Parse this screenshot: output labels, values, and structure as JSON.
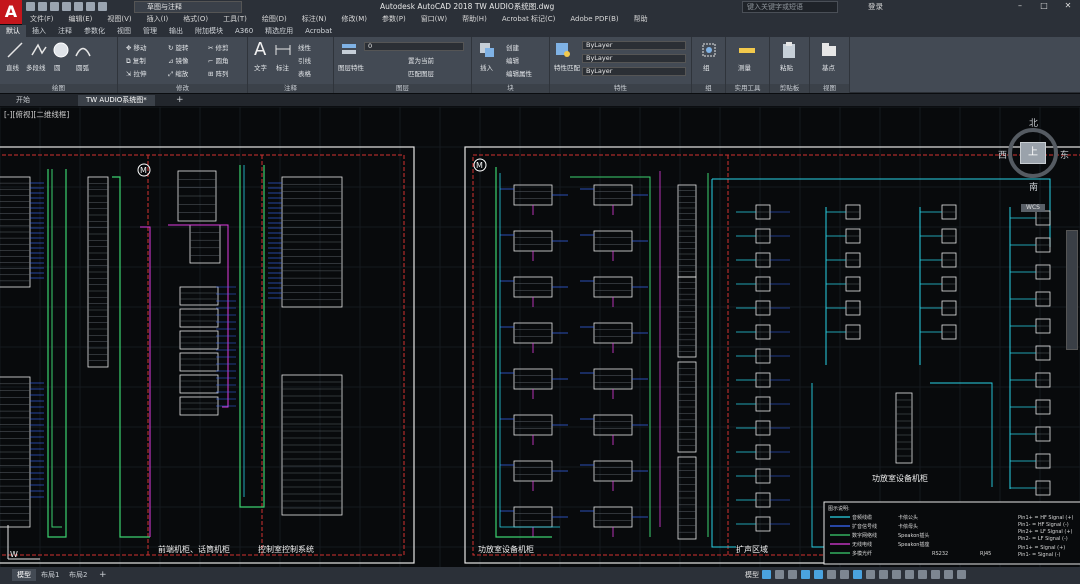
{
  "app": {
    "title": "Autodesk AutoCAD 2018    TW AUDIO系统图.dwg",
    "logo_letter": "A",
    "workspace": "草图与注释",
    "search_placeholder": "键入关键字或短语",
    "login": "登录"
  },
  "menu": [
    "文件(F)",
    "编辑(E)",
    "视图(V)",
    "插入(I)",
    "格式(O)",
    "工具(T)",
    "绘图(D)",
    "标注(N)",
    "修改(M)",
    "参数(P)",
    "窗口(W)",
    "帮助(H)",
    "Acrobat 标记(C)",
    "Adobe PDF(B)",
    "帮助"
  ],
  "ribbon_tabs": [
    "默认",
    "插入",
    "注释",
    "参数化",
    "视图",
    "管理",
    "输出",
    "附加模块",
    "A360",
    "精选应用",
    "Acrobat"
  ],
  "ribbon": {
    "draw": {
      "label": "绘图",
      "tools": [
        "直线",
        "多段线",
        "圆",
        "圆弧"
      ]
    },
    "modify": {
      "label": "修改",
      "tools": [
        "移动",
        "旋转",
        "修剪",
        "复制",
        "镜像",
        "圆角",
        "拉伸",
        "缩放",
        "阵列"
      ]
    },
    "annotation": {
      "label": "注释",
      "tools": [
        "文字",
        "标注",
        "线性",
        "引线",
        "表格"
      ]
    },
    "layers": {
      "label": "图层",
      "tools": [
        "图层特性",
        "置为当前",
        "匹配图层"
      ],
      "current_layer": "0"
    },
    "block": {
      "label": "块",
      "tools": [
        "插入",
        "创建",
        "编辑",
        "编辑属性"
      ]
    },
    "properties": {
      "label": "特性",
      "tools": [
        "特性匹配"
      ],
      "color": "ByLayer",
      "linetype": "ByLayer",
      "lineweight": "ByLayer"
    },
    "groups": {
      "label": "组",
      "tools": [
        "组"
      ]
    },
    "utilities": {
      "label": "实用工具",
      "tools": [
        "测量"
      ]
    },
    "clipboard": {
      "label": "剪贴板",
      "tools": [
        "粘贴"
      ]
    },
    "view": {
      "label": "视图",
      "tools": [
        "基点"
      ]
    }
  },
  "file_tabs": [
    "开始",
    "TW AUDIO系统图*"
  ],
  "viewport_label": "[-][俯视][二维线框]",
  "viewcube": {
    "north": "北",
    "south": "南",
    "east": "东",
    "west": "西",
    "top": "上",
    "wcs": "WCS"
  },
  "drawing": {
    "left_sheet_labels": [
      "前端机柜、话筒机柜",
      "控制室控制系统"
    ],
    "right_sheet_labels": [
      "功放室设备机柜",
      "扩声区域",
      "功放室设备机柜"
    ],
    "legend_title": "图示说明:",
    "legend_items": [
      "音频线缆",
      "扩音信号线",
      "数字网络线",
      "无线电线",
      "多模光纤"
    ],
    "legend_symbols": [
      "卡侬公头",
      "卡侬母头",
      "Speakon插头",
      "Speakon插座",
      "RS232",
      "RJ45"
    ],
    "legend_pins": [
      "Pin1+ = HF Signal (+)",
      "Pin1- = HF Signal (-)",
      "Pin2+ = LF Signal (+)",
      "Pin2- = LF Signal (-)",
      "Pin1+ = Signal (+)",
      "Pin1- = Signal (-)"
    ]
  },
  "layout_tabs": [
    "模型",
    "布局1",
    "布局2"
  ],
  "status": {
    "model": "模型"
  },
  "colors": {
    "accent": "#4aa3df",
    "brand_red": "#c4161c",
    "line_green": "#3bd16f",
    "line_magenta": "#e03ce0",
    "line_cyan": "#29d3e6",
    "line_blue": "#3a6bff",
    "frame_red": "#d23131"
  }
}
